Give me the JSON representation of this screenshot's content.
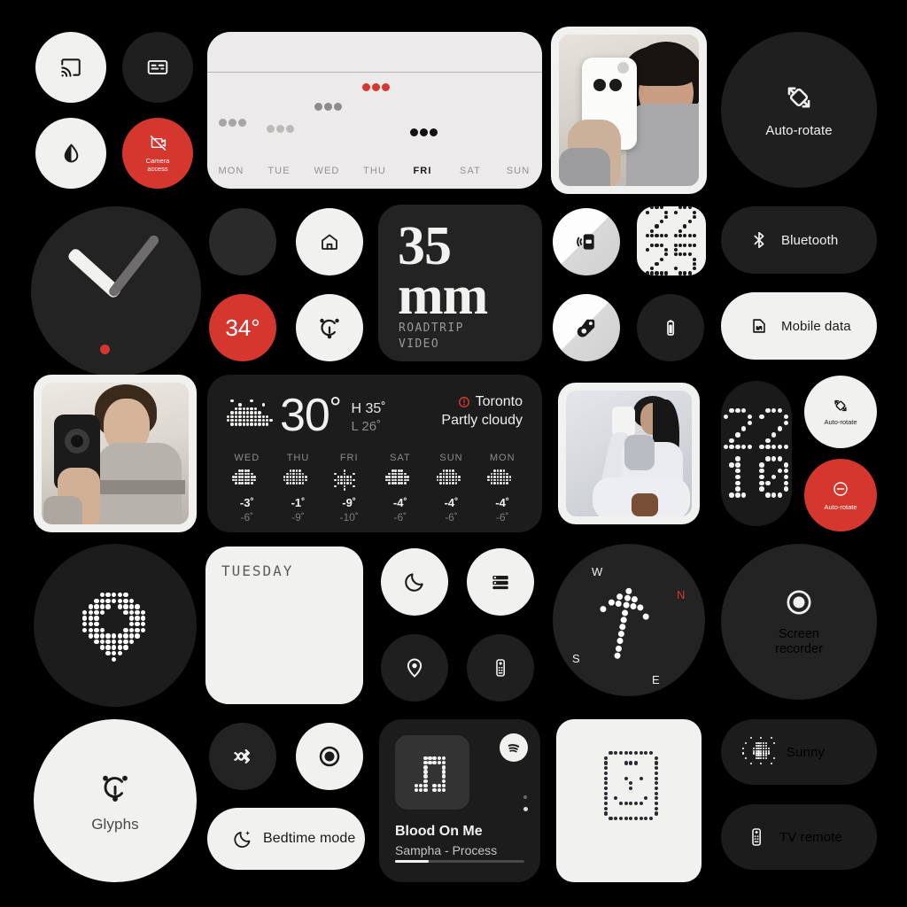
{
  "meta": {
    "background": "#000000",
    "accent_red": "#d5372f",
    "light": "#f1f1f0",
    "dark": "#1f1f1f"
  },
  "quick_settings": {
    "cast": {
      "label": "",
      "icon": "cast-icon"
    },
    "captions": {
      "label": "",
      "icon": "captions-icon"
    },
    "contrast": {
      "label": "",
      "icon": "contrast-droplet-icon"
    },
    "camera_access": {
      "label": "Camera\naccess",
      "line1": "Camera",
      "line2": "access",
      "icon": "camera-off-icon"
    },
    "auto_rotate": {
      "label": "Auto-rotate",
      "icon": "auto-rotate-icon"
    },
    "bluetooth": {
      "label": "Bluetooth",
      "icon": "bluetooth-icon"
    },
    "mobile_data": {
      "label": "Mobile data",
      "icon": "sim-card-icon"
    },
    "screen_recorder": {
      "label": "Screen recorder",
      "line1": "Screen",
      "line2": "recorder",
      "icon": "record-icon"
    },
    "sunny": {
      "label": "Sunny",
      "icon": "sun-dot-matrix-icon"
    },
    "tv_remote": {
      "label": "TV remote",
      "icon": "remote-icon"
    },
    "bedtime_mode": {
      "label": "Bedtime mode",
      "icon": "moon-star-icon"
    },
    "glyphs": {
      "label": "Glyphs",
      "icon": "glyph-c-icon"
    },
    "auto_rotate_small": {
      "label": "Auto-rotate",
      "icon": "auto-rotate-icon"
    },
    "auto_rotate_off": {
      "label": "Auto-rotate",
      "icon": "minus-circle-icon"
    },
    "home": {
      "label": "",
      "icon": "home-icon"
    },
    "temp_chip": {
      "label": "34°",
      "icon": ""
    },
    "celsius_glyph": {
      "label": "",
      "icon": "glyph-c-icon"
    },
    "moon": {
      "label": "",
      "icon": "moon-icon"
    },
    "list": {
      "label": "",
      "icon": "list-icon"
    },
    "location": {
      "label": "",
      "icon": "location-pin-icon"
    },
    "remote_small": {
      "label": "",
      "icon": "remote-icon"
    },
    "shuffle": {
      "label": "",
      "icon": "shuffle-icon"
    },
    "record_small": {
      "label": "",
      "icon": "record-icon"
    },
    "flip_camera": {
      "label": "",
      "icon": "flip-camera-icon"
    },
    "battery": {
      "label": "",
      "icon": "battery-icon"
    },
    "nfc": {
      "label": "",
      "icon": "nfc-tag-icon"
    },
    "phone_hold": {
      "label": "",
      "icon": "phone-vibrate-icon"
    }
  },
  "week_widget": {
    "days": [
      {
        "label": "MON",
        "active": false,
        "color": "#a9a5a4",
        "level": 0.45
      },
      {
        "label": "TUE",
        "active": false,
        "color": "#bdb9b8",
        "level": 0.38
      },
      {
        "label": "WED",
        "active": false,
        "color": "#8f8b8a",
        "level": 0.64
      },
      {
        "label": "THU",
        "active": false,
        "color": "#d5372f",
        "level": 0.86
      },
      {
        "label": "FRI",
        "active": true,
        "color": "#111111",
        "level": 0.33
      },
      {
        "label": "SAT",
        "active": false,
        "color": "#a9a5a4",
        "level": 0
      },
      {
        "label": "SUN",
        "active": false,
        "color": "#a9a5a4",
        "level": 0
      }
    ]
  },
  "film_widget": {
    "number": "35",
    "unit": "mm",
    "line1": "ROADTRIP",
    "line2": "VIDEO"
  },
  "clock_digital_top": {
    "hours": "22",
    "minutes": "25"
  },
  "clock_digital_side": {
    "hours": "22",
    "minutes": "10"
  },
  "note_widget": {
    "title": "TUESDAY",
    "body": ""
  },
  "weather": {
    "temperature": "30",
    "degree": "°",
    "high": "H 35˚",
    "low": "L 26˚",
    "city": "Toronto",
    "condition": "Partly cloudy",
    "forecast": [
      {
        "day": "WED",
        "icon": "cloud",
        "high": "-3˚",
        "low": "-6˚"
      },
      {
        "day": "THU",
        "icon": "cloud",
        "high": "-1˚",
        "low": "-9˚"
      },
      {
        "day": "FRI",
        "icon": "snow",
        "high": "-9˚",
        "low": "-10˚"
      },
      {
        "day": "SAT",
        "icon": "cloud",
        "high": "-4˚",
        "low": "-6˚"
      },
      {
        "day": "SUN",
        "icon": "cloud",
        "high": "-4˚",
        "low": "-6˚"
      },
      {
        "day": "MON",
        "icon": "cloud",
        "high": "-4˚",
        "low": "-6˚"
      }
    ]
  },
  "compass": {
    "n": "N",
    "e": "E",
    "s": "S",
    "w": "W"
  },
  "music_player": {
    "title": "Blood On Me",
    "artist_album": "Sampha - Process",
    "service": "spotify-icon",
    "progress_percent": 26
  },
  "photos": {
    "photo_top_right": "person-holding-phone-selfie",
    "photo_mid_left": "person-holding-phone-selfie",
    "photo_mid_right": "person-seated-with-phone"
  },
  "misc": {
    "heart_dot_widget": "dot-matrix-pin-icon",
    "phone_face_widget": "dot-matrix-phone-face-icon"
  }
}
